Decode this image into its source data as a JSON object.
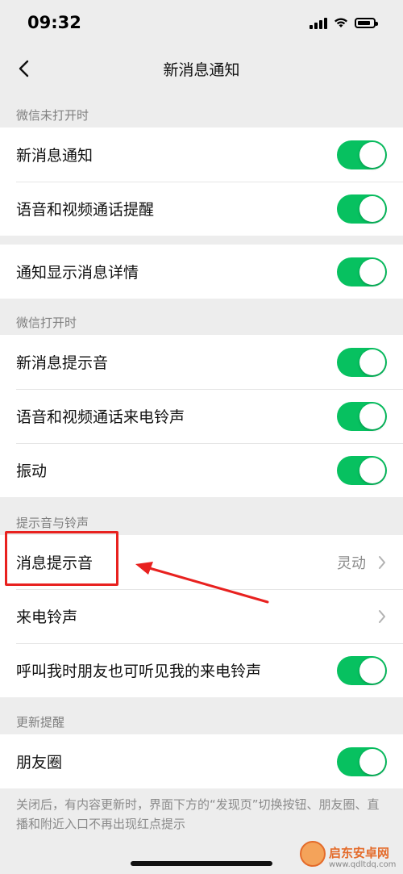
{
  "status_bar": {
    "time": "09:32"
  },
  "nav": {
    "title": "新消息通知",
    "back_icon": "chevron-left-icon"
  },
  "sections": [
    {
      "header": "微信未打开时",
      "groups": [
        {
          "items": [
            {
              "label": "新消息通知",
              "toggle": true
            },
            {
              "label": "语音和视频通话提醒",
              "toggle": true
            }
          ]
        },
        {
          "items": [
            {
              "label": "通知显示消息详情",
              "toggle": true
            }
          ]
        }
      ]
    },
    {
      "header": "微信打开时",
      "groups": [
        {
          "items": [
            {
              "label": "新消息提示音",
              "toggle": true
            },
            {
              "label": "语音和视频通话来电铃声",
              "toggle": true
            },
            {
              "label": "振动",
              "toggle": true
            }
          ]
        }
      ]
    },
    {
      "header": "提示音与铃声",
      "groups": [
        {
          "items": [
            {
              "label": "消息提示音",
              "value": "灵动",
              "chevron": true
            },
            {
              "label": "来电铃声",
              "chevron": true
            },
            {
              "label": "呼叫我时朋友也可听见我的来电铃声",
              "toggle": true
            }
          ]
        }
      ]
    },
    {
      "header": "更新提醒",
      "groups": [
        {
          "items": [
            {
              "label": "朋友圈",
              "toggle": true
            }
          ]
        }
      ]
    }
  ],
  "footer_note": "关闭后，有内容更新时，界面下方的“发现页”切换按钮、朋友圈、直播和附近入口不再出现红点提示",
  "colors": {
    "toggle_on": "#07c160",
    "annotation_red": "#e8211f",
    "background": "#ededed"
  },
  "watermark": {
    "text": "启东安卓网",
    "url": "www.qdltdq.com"
  }
}
